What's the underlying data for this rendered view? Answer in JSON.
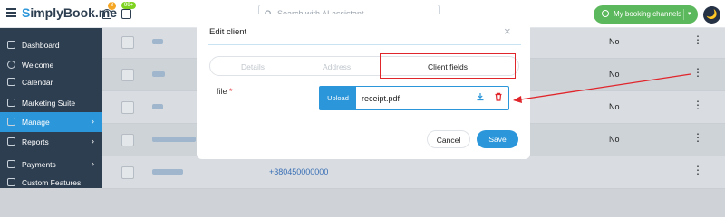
{
  "header": {
    "logo_s": "S",
    "logo_rest": "implyBook.me",
    "notifications_count": "3",
    "calendar_badge": "99+",
    "search_placeholder": "Search with AI assistant",
    "booking_channels_label": "My booking channels",
    "theme_icon": "🌙"
  },
  "sidebar": {
    "items": [
      {
        "label": "Dashboard",
        "icon": "dashboard-icon"
      },
      {
        "label": "Welcome",
        "icon": "lightbulb-icon"
      },
      {
        "label": "Calendar",
        "icon": "calendar-icon"
      },
      {
        "label": "Marketing Suite",
        "icon": "megaphone-icon"
      },
      {
        "label": "Manage",
        "icon": "pencil-icon",
        "active": true,
        "chevron": "›"
      },
      {
        "label": "Reports",
        "icon": "chart-icon",
        "chevron": "›"
      },
      {
        "label": "Payments",
        "icon": "link-icon",
        "chevron": "›"
      },
      {
        "label": "Custom Features",
        "icon": "puzzle-icon"
      }
    ]
  },
  "table": {
    "rows": [
      {
        "no": "No",
        "phone": ""
      },
      {
        "no": "No",
        "phone": ""
      },
      {
        "no": "No",
        "phone": ""
      },
      {
        "no": "No",
        "phone": ""
      },
      {
        "no": "",
        "phone": "+380450000000"
      }
    ],
    "kebab": "⋮"
  },
  "modal": {
    "title": "Edit client",
    "close": "×",
    "tabs": [
      "Details",
      "Address",
      "Client fields"
    ],
    "active_tab": "Client fields",
    "field_label": "file",
    "required_mark": "*",
    "upload_label": "Upload",
    "file_name": "receipt.pdf",
    "cancel_label": "Cancel",
    "save_label": "Save"
  },
  "colors": {
    "sidebar_bg": "#2d3e50",
    "accent": "#2b96d9",
    "highlight": "#e0252b",
    "channels_green": "#5cb85c"
  }
}
